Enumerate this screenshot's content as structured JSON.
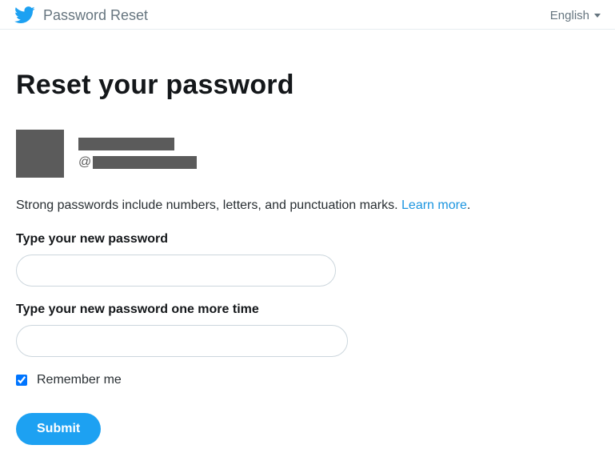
{
  "topbar": {
    "title": "Password Reset",
    "language": "English"
  },
  "page": {
    "heading": "Reset your password",
    "user": {
      "at_prefix": "@"
    },
    "hint_text": "Strong passwords include numbers, letters, and punctuation marks. ",
    "hint_link": "Learn more",
    "hint_suffix": ".",
    "field1_label": "Type your new password",
    "field2_label": "Type your new password one more time",
    "remember_label": "Remember me",
    "remember_checked": true,
    "submit_label": "Submit"
  },
  "colors": {
    "accent": "#1da1f2",
    "link": "#1b95e0",
    "muted": "#66757f"
  }
}
